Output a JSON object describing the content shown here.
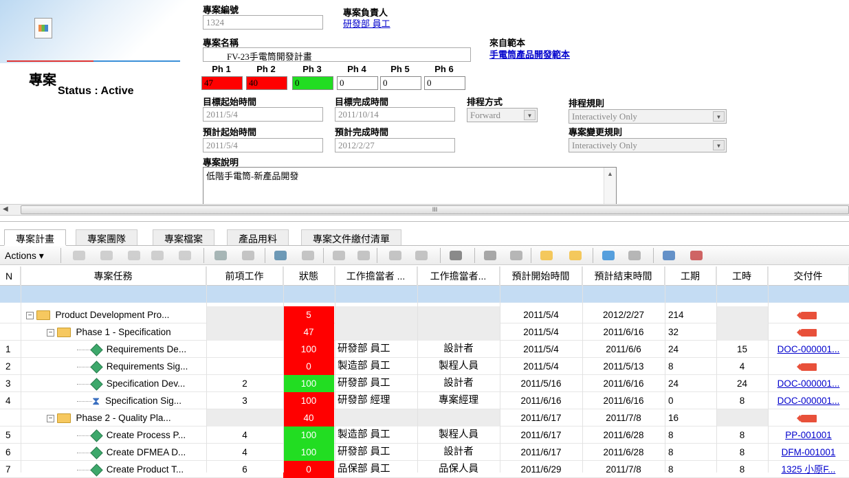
{
  "header": {
    "title": "專案",
    "status": "Status : Active",
    "project_no_label": "專案編號",
    "project_no": "1324",
    "owner_label": "專案負責人",
    "owner": "研發部 員工",
    "name_label": "專案名稱",
    "name": "FV-23手電筒開發計畫",
    "template_label": "來自範本",
    "template": "手電筒產品開發範本",
    "phases": [
      {
        "label": "Ph 1",
        "value": "47",
        "color": "#ff0000"
      },
      {
        "label": "Ph 2",
        "value": "40",
        "color": "#ff0000"
      },
      {
        "label": "Ph 3",
        "value": "0",
        "color": "#22dd22"
      },
      {
        "label": "Ph 4",
        "value": "0",
        "color": "#ffffff"
      },
      {
        "label": "Ph 5",
        "value": "0",
        "color": "#ffffff"
      },
      {
        "label": "Ph 6",
        "value": "0",
        "color": "#ffffff"
      }
    ],
    "target_start_label": "目標起始時間",
    "target_start": "2011/5/4",
    "target_end_label": "目標完成時間",
    "target_end": "2011/10/14",
    "schedule_mode_label": "排程方式",
    "schedule_mode": "Forward",
    "schedule_rule_label": "排程規則",
    "schedule_rule": "Interactively Only",
    "est_start_label": "預計起始時間",
    "est_start": "2011/5/4",
    "est_end_label": "預計完成時間",
    "est_end": "2012/2/27",
    "change_rule_label": "專案變更規則",
    "change_rule": "Interactively Only",
    "desc_label": "專案說明",
    "desc": "低階手電筒-新產品開發"
  },
  "scrollbar_grip": "III",
  "tabs": [
    "專案計畫",
    "專案團隊",
    "專案檔案",
    "產品用料",
    "專案文件繳付清單"
  ],
  "toolbar": {
    "actions": "Actions ▾"
  },
  "columns": [
    "N",
    "專案任務",
    "前項工作",
    "狀態",
    "工作擔當者 ...",
    "工作擔當者...",
    "預計開始時間",
    "預計結束時間",
    "工期",
    "工時",
    "交付件"
  ],
  "rows": [
    {
      "n": "",
      "level": 0,
      "kind": "folder",
      "task": "Product Development Pro...",
      "pred": "",
      "status": "5",
      "sc": "red",
      "o1": "",
      "o2": "",
      "start": "2011/5/4",
      "end": "2012/2/27",
      "dur": "214",
      "hrs": "",
      "deliv": "",
      "dtype": "tag",
      "grey": true
    },
    {
      "n": "",
      "level": 1,
      "kind": "folder",
      "task": "Phase 1 - Specification",
      "pred": "",
      "status": "47",
      "sc": "red",
      "o1": "",
      "o2": "",
      "start": "2011/5/4",
      "end": "2011/6/16",
      "dur": "32",
      "hrs": "",
      "deliv": "",
      "dtype": "tag",
      "grey": true
    },
    {
      "n": "1",
      "level": 2,
      "kind": "task",
      "task": "Requirements De...",
      "pred": "",
      "status": "100",
      "sc": "red",
      "o1": "研發部 員工",
      "o2": "設計者",
      "start": "2011/5/4",
      "end": "2011/6/6",
      "dur": "24",
      "hrs": "15",
      "deliv": "DOC-000001...",
      "dtype": "link",
      "grey": false
    },
    {
      "n": "2",
      "level": 2,
      "kind": "task",
      "task": "Requirements Sig...",
      "pred": "",
      "status": "0",
      "sc": "red",
      "o1": "製造部 員工",
      "o2": "製程人員",
      "start": "2011/5/4",
      "end": "2011/5/13",
      "dur": "8",
      "hrs": "4",
      "deliv": "",
      "dtype": "tag",
      "grey": false
    },
    {
      "n": "3",
      "level": 2,
      "kind": "task",
      "task": "Specification Dev...",
      "pred": "2",
      "status": "100",
      "sc": "grn",
      "o1": "研發部 員工",
      "o2": "設計者",
      "start": "2011/5/16",
      "end": "2011/6/16",
      "dur": "24",
      "hrs": "24",
      "deliv": "DOC-000001...",
      "dtype": "link",
      "grey": false
    },
    {
      "n": "4",
      "level": 2,
      "kind": "gate",
      "task": "Specification Sig...",
      "pred": "3",
      "status": "100",
      "sc": "red",
      "o1": "研發部 經理",
      "o2": "專案經理",
      "start": "2011/6/16",
      "end": "2011/6/16",
      "dur": "0",
      "hrs": "8",
      "deliv": "DOC-000001...",
      "dtype": "link",
      "grey": false
    },
    {
      "n": "",
      "level": 1,
      "kind": "folder",
      "task": "Phase 2 - Quality Pla...",
      "pred": "",
      "status": "40",
      "sc": "red",
      "o1": "",
      "o2": "",
      "start": "2011/6/17",
      "end": "2011/7/8",
      "dur": "16",
      "hrs": "",
      "deliv": "",
      "dtype": "tag",
      "grey": true
    },
    {
      "n": "5",
      "level": 2,
      "kind": "task",
      "task": "Create Process P...",
      "pred": "4",
      "status": "100",
      "sc": "grn",
      "o1": "製造部 員工",
      "o2": "製程人員",
      "start": "2011/6/17",
      "end": "2011/6/28",
      "dur": "8",
      "hrs": "8",
      "deliv": "PP-001001",
      "dtype": "link",
      "grey": false
    },
    {
      "n": "6",
      "level": 2,
      "kind": "task",
      "task": "Create DFMEA D...",
      "pred": "4",
      "status": "100",
      "sc": "grn",
      "o1": "研發部 員工",
      "o2": "設計者",
      "start": "2011/6/17",
      "end": "2011/6/28",
      "dur": "8",
      "hrs": "8",
      "deliv": "DFM-001001",
      "dtype": "link",
      "grey": false
    },
    {
      "n": "7",
      "level": 2,
      "kind": "task",
      "task": "Create Product T...",
      "pred": "6",
      "status": "0",
      "sc": "red",
      "o1": "品保部 員工",
      "o2": "品保人員",
      "start": "2011/6/29",
      "end": "2011/7/8",
      "dur": "8",
      "hrs": "8",
      "deliv": "1325 小原F...",
      "dtype": "link",
      "grey": false
    }
  ]
}
